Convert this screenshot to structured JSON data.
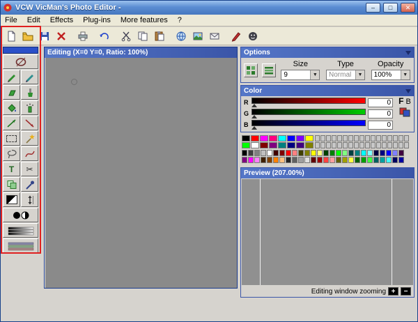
{
  "window": {
    "title": "VCW VicMan's Photo Editor -",
    "minimize": "–",
    "maximize": "□",
    "close": "✕"
  },
  "menu": {
    "items": [
      "File",
      "Edit",
      "Effects",
      "Plug-ins",
      "More features",
      "?"
    ]
  },
  "toolbar": {
    "icons": [
      "new-document-icon",
      "open-folder-icon",
      "save-icon",
      "delete-icon",
      "print-icon",
      "undo-icon",
      "cut-icon",
      "copy-icon",
      "paste-icon",
      "globe-icon",
      "image-icon",
      "mail-icon",
      "red-pen-icon",
      "about-icon"
    ]
  },
  "tool_palette": {
    "tools": [
      "ellipse-tool",
      "pencil-tool",
      "pen-tool",
      "eraser-tool",
      "brush-tool",
      "fill-tool",
      "spray-tool",
      "line-tool",
      "arrow-tool",
      "rect-select-tool",
      "magic-wand-tool",
      "lasso-tool",
      "curve-tool",
      "text-tool",
      "scissors-tool",
      "clone-tool",
      "eyedropper-tool",
      "gradient-tool",
      "resize-tool",
      "invert-tool",
      "levels-tool",
      "curves-tool"
    ]
  },
  "editing_window": {
    "title": "Editing (X=0 Y=0, Ratio: 100%)"
  },
  "options_panel": {
    "title": "Options",
    "icons": [
      "brush-shape-icon",
      "brush-pattern-icon"
    ],
    "size_label": "Size",
    "size_value": "9",
    "type_label": "Type",
    "type_value": "Normal",
    "opacity_label": "Opacity",
    "opacity_value": "100%"
  },
  "color_panel": {
    "title": "Color",
    "channels": [
      {
        "label": "R",
        "value": "0"
      },
      {
        "label": "G",
        "value": "0"
      },
      {
        "label": "B",
        "value": "0"
      }
    ],
    "foreground_label": "F",
    "background_label": "B"
  },
  "palette": {
    "bright_rows": [
      [
        "#000000",
        "#ff0000",
        "#ff00ff",
        "#ff0080",
        "#00ffff",
        "#0000ff",
        "#8000ff",
        "#ffff00"
      ],
      [
        "#00ff00",
        "#ffffff",
        "#800000",
        "#800080",
        "#008080",
        "#000080",
        "#400080",
        "#808000"
      ]
    ],
    "slots": {
      "count": 17,
      "rows": 2,
      "color": "#c8c8c8"
    },
    "spectrum_rows": [
      [
        "#000000",
        "#404040",
        "#808080",
        "#c0c0c0",
        "#ffffff",
        "#400000",
        "#800000",
        "#ff0000",
        "#ff8080",
        "#404000",
        "#808000",
        "#ffff00",
        "#ffff80",
        "#004000",
        "#008000",
        "#00ff00",
        "#80ff80",
        "#004040",
        "#008080",
        "#00ffff",
        "#80ffff",
        "#000040",
        "#000080",
        "#0000ff",
        "#8080ff",
        "#400040"
      ],
      [
        "#800080",
        "#ff00ff",
        "#ff80ff",
        "#402000",
        "#804000",
        "#ff8000",
        "#ffc080",
        "#202020",
        "#606060",
        "#a0a0a0",
        "#e0e0e0",
        "#600000",
        "#a00000",
        "#ff4040",
        "#ffa0a0",
        "#606000",
        "#a0a000",
        "#ffff40",
        "#006000",
        "#00a000",
        "#40ff40",
        "#006060",
        "#00a0a0",
        "#40ffff",
        "#000060",
        "#0000a0"
      ]
    ]
  },
  "preview_panel": {
    "title": "Preview (207.00%)",
    "zoom_label": "Editing window zooming",
    "zoom_in": "+",
    "zoom_out": "−"
  }
}
